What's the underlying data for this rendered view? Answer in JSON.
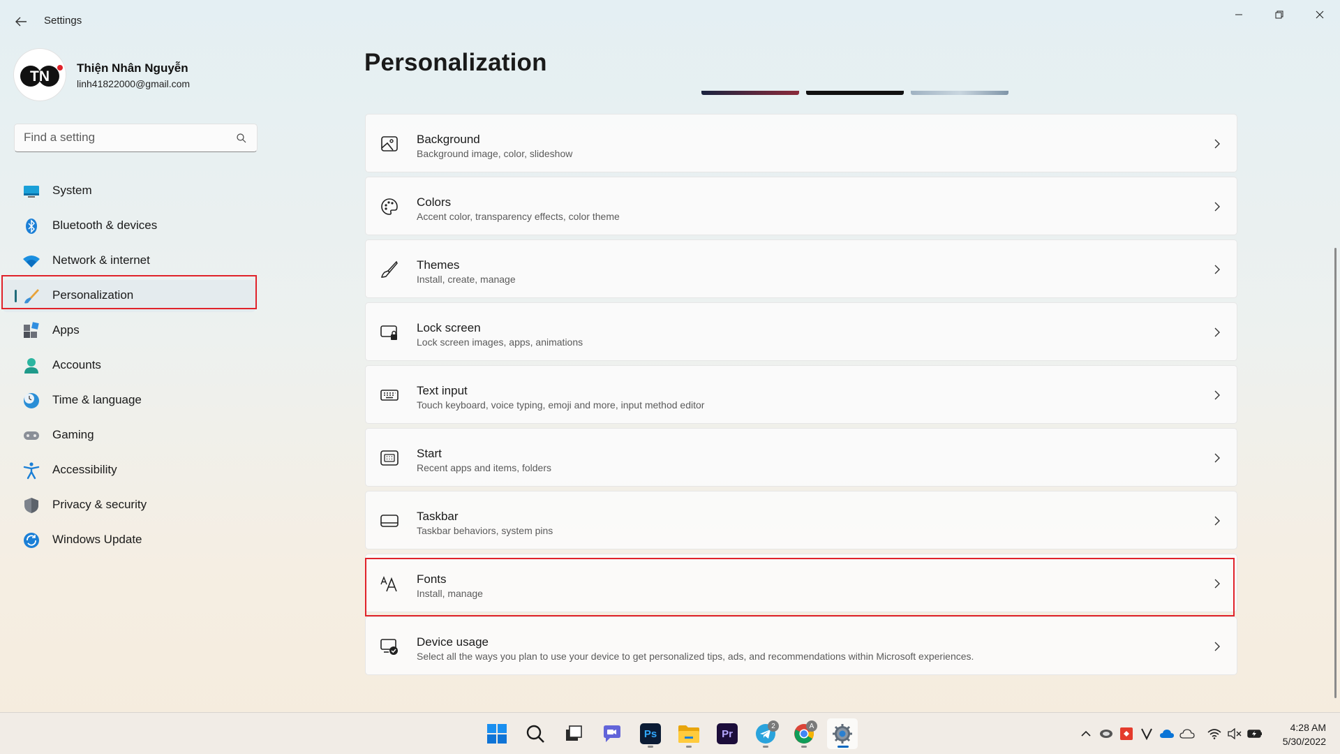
{
  "window": {
    "title": "Settings"
  },
  "profile": {
    "initials": "TN",
    "name": "Thiện Nhân Nguyễn",
    "email": "linh41822000@gmail.com"
  },
  "search": {
    "placeholder": "Find a setting"
  },
  "nav": {
    "items": [
      {
        "label": "System",
        "icon": "system-icon"
      },
      {
        "label": "Bluetooth & devices",
        "icon": "bluetooth-icon"
      },
      {
        "label": "Network & internet",
        "icon": "wifi-icon"
      },
      {
        "label": "Personalization",
        "icon": "brush-icon",
        "selected": true
      },
      {
        "label": "Apps",
        "icon": "apps-icon"
      },
      {
        "label": "Accounts",
        "icon": "accounts-icon"
      },
      {
        "label": "Time & language",
        "icon": "globe-clock-icon"
      },
      {
        "label": "Gaming",
        "icon": "gamepad-icon"
      },
      {
        "label": "Accessibility",
        "icon": "accessibility-icon"
      },
      {
        "label": "Privacy & security",
        "icon": "shield-icon"
      },
      {
        "label": "Windows Update",
        "icon": "update-icon"
      }
    ]
  },
  "main": {
    "title": "Personalization",
    "cards": [
      {
        "title": "Background",
        "subtitle": "Background image, color, slideshow",
        "icon": "image-icon"
      },
      {
        "title": "Colors",
        "subtitle": "Accent color, transparency effects, color theme",
        "icon": "palette-icon"
      },
      {
        "title": "Themes",
        "subtitle": "Install, create, manage",
        "icon": "brush-icon"
      },
      {
        "title": "Lock screen",
        "subtitle": "Lock screen images, apps, animations",
        "icon": "lock-screen-icon"
      },
      {
        "title": "Text input",
        "subtitle": "Touch keyboard, voice typing, emoji and more, input method editor",
        "icon": "keyboard-icon"
      },
      {
        "title": "Start",
        "subtitle": "Recent apps and items, folders",
        "icon": "start-icon"
      },
      {
        "title": "Taskbar",
        "subtitle": "Taskbar behaviors, system pins",
        "icon": "taskbar-icon"
      },
      {
        "title": "Fonts",
        "subtitle": "Install, manage",
        "icon": "fonts-icon",
        "highlighted": true
      },
      {
        "title": "Device usage",
        "subtitle": "Select all the ways you plan to use your device to get personalized tips, ads, and recommendations within Microsoft experiences.",
        "icon": "device-usage-icon"
      }
    ]
  },
  "taskbar": {
    "apps": [
      "start-icon",
      "search-icon",
      "task-view-icon",
      "teams-chat-icon",
      "photoshop-icon",
      "file-explorer-icon",
      "premiere-icon",
      "telegram-icon",
      "chrome-icon",
      "settings-icon"
    ],
    "app_labels": {
      "photoshop": "Ps",
      "premiere": "Pr"
    },
    "telegram_badge": "2",
    "chrome_badge": "A",
    "clock": {
      "time": "4:28 AM",
      "date": "5/30/2022"
    }
  },
  "colors": {
    "accent": "#0067c0",
    "highlight": "#e0222a",
    "nav_selected": "#e4ebee"
  }
}
